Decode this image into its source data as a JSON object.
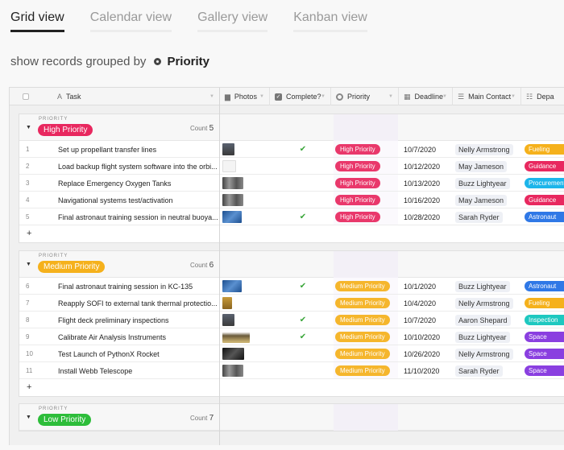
{
  "tabs": [
    {
      "label": "Grid view",
      "active": true
    },
    {
      "label": "Calendar view",
      "active": false
    },
    {
      "label": "Gallery view",
      "active": false
    },
    {
      "label": "Kanban view",
      "active": false
    }
  ],
  "groupby": {
    "prefix": "show records grouped by",
    "field": "Priority"
  },
  "columns": {
    "task": "Task",
    "photos": "Photos",
    "complete": "Complete?",
    "priority": "Priority",
    "deadline": "Deadline",
    "contact": "Main Contact",
    "dept": "Depa"
  },
  "colors": {
    "high": "#e8285f",
    "medium": "#f5b11c",
    "low": "#2dbd3a",
    "fueling": "#f5b11c",
    "guidance": "#e8285f",
    "procurement": "#1cb5ea",
    "astronaut": "#2f78e6",
    "inspection": "#1ec8c0",
    "space": "#8a3fe0"
  },
  "group_label": "PRIORITY",
  "count_label": "Count",
  "groups": [
    {
      "name": "High Priority",
      "color": "#e8285f",
      "count": "5",
      "rows": [
        {
          "num": "1",
          "task": "Set up propellant transfer lines",
          "photo": "dark",
          "complete": true,
          "priority": "High Priority",
          "deadline": "10/7/2020",
          "contact": "Nelly Armstrong",
          "dept": "Fueling",
          "dept_color": "#f5b11c"
        },
        {
          "num": "2",
          "task": "Load backup flight system software into the orbi...",
          "photo": "blank",
          "complete": false,
          "priority": "High Priority",
          "deadline": "10/12/2020",
          "contact": "May Jameson",
          "dept": "Guidance",
          "dept_color": "#e8285f"
        },
        {
          "num": "3",
          "task": "Replace Emergency Oxygen Tanks",
          "photo": "grey",
          "complete": false,
          "priority": "High Priority",
          "deadline": "10/13/2020",
          "contact": "Buzz Lightyear",
          "dept": "Procurement",
          "dept_color": "#1cb5ea"
        },
        {
          "num": "4",
          "task": "Navigational systems test/activation",
          "photo": "grey",
          "complete": false,
          "priority": "High Priority",
          "deadline": "10/16/2020",
          "contact": "May Jameson",
          "dept": "Guidance",
          "dept_color": "#e8285f"
        },
        {
          "num": "5",
          "task": "Final astronaut training session in neutral buoya...",
          "photo": "blue",
          "complete": true,
          "priority": "High Priority",
          "deadline": "10/28/2020",
          "contact": "Sarah Ryder",
          "dept": "Astronaut",
          "dept_color": "#2f78e6"
        }
      ]
    },
    {
      "name": "Medium Priority",
      "color": "#f5b11c",
      "count": "6",
      "rows": [
        {
          "num": "6",
          "task": "Final astronaut training session in KC-135",
          "photo": "blue",
          "complete": true,
          "priority": "Medium Priority",
          "deadline": "10/1/2020",
          "contact": "Buzz Lightyear",
          "dept": "Astronaut",
          "dept_color": "#2f78e6"
        },
        {
          "num": "7",
          "task": "Reapply SOFI to external tank thermal protectio...",
          "photo": "gold",
          "complete": false,
          "priority": "Medium Priority",
          "deadline": "10/4/2020",
          "contact": "Nelly Armstrong",
          "dept": "Fueling",
          "dept_color": "#f5b11c"
        },
        {
          "num": "8",
          "task": "Flight deck preliminary inspections",
          "photo": "dark",
          "complete": true,
          "priority": "Medium Priority",
          "deadline": "10/7/2020",
          "contact": "Aaron Shepard",
          "dept": "Inspection",
          "dept_color": "#1ec8c0"
        },
        {
          "num": "9",
          "task": "Calibrate Air Analysis Instruments",
          "photo": "dome",
          "complete": true,
          "priority": "Medium Priority",
          "deadline": "10/10/2020",
          "contact": "Buzz Lightyear",
          "dept": "Space",
          "dept_color": "#8a3fe0"
        },
        {
          "num": "10",
          "task": "Test Launch of PythonX Rocket",
          "photo": "black",
          "complete": false,
          "priority": "Medium Priority",
          "deadline": "10/26/2020",
          "contact": "Nelly Armstrong",
          "dept": "Space",
          "dept_color": "#8a3fe0"
        },
        {
          "num": "11",
          "task": "Install Webb Telescope",
          "photo": "grey",
          "complete": false,
          "priority": "Medium Priority",
          "deadline": "11/10/2020",
          "contact": "Sarah Ryder",
          "dept": "Space",
          "dept_color": "#8a3fe0"
        }
      ]
    },
    {
      "name": "Low Priority",
      "color": "#2dbd3a",
      "count": "7",
      "rows": []
    }
  ],
  "add_label": "+"
}
